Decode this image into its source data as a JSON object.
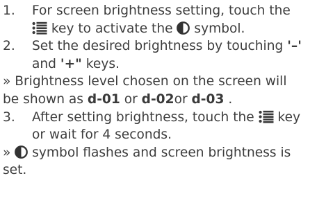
{
  "icons": {
    "menu": "menu-key-icon",
    "brightness": "half-filled-circle-brightness-icon"
  },
  "step1": {
    "number": "1.",
    "line1": "For screen brightness setting, touch the",
    "line2_after_icon": " key to activate the ",
    "line2_end": " symbol."
  },
  "step2": {
    "number": "2.",
    "line1_text": "Set the desired brightness by touching ",
    "minus_key": "'–'",
    "line2_and": "and ",
    "plus_key": "'+\"",
    "line2_end": " keys."
  },
  "note1": {
    "line1": "» Brightness level chosen on the screen will",
    "line2_prefix": "be shown as ",
    "level1": "d-01",
    "or1": " or ",
    "level2": "d-02",
    "or2": "or ",
    "level3": "d-03",
    "line2_end": " ."
  },
  "step3": {
    "number": "3.",
    "line1_text": "After setting brightness, touch the ",
    "line1_end": " key",
    "line2": "or wait for 4 seconds."
  },
  "note2": {
    "prefix": "» ",
    "line1_text": " symbol flashes and screen brightness is",
    "line2": "set."
  }
}
